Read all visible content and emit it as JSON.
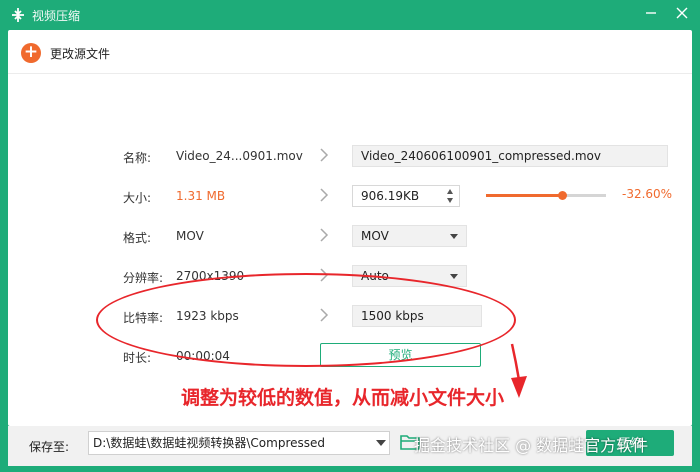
{
  "window": {
    "title": "视频压缩",
    "icons": {
      "logo": "compress-logo-icon",
      "minimize": "minimize-icon",
      "close": "close-icon"
    }
  },
  "toolbar": {
    "add_icon": "+",
    "change_source_label": "更改源文件"
  },
  "fields": {
    "name": {
      "label": "名称:",
      "source": "Video_24...0901.mov",
      "output": "Video_240606100901_compressed.mov"
    },
    "size": {
      "label": "大小:",
      "source": "1.31 MB",
      "output": "906.19KB",
      "percent": "-32.60%",
      "slider_value": 0.64
    },
    "format": {
      "label": "格式:",
      "source": "MOV",
      "output": "MOV"
    },
    "resolution": {
      "label": "分辨率:",
      "source": "2700x1390",
      "output": "Auto"
    },
    "bitrate": {
      "label": "比特率:",
      "source": "1923 kbps",
      "output": "1500 kbps"
    },
    "duration": {
      "label": "时长:",
      "source": "00:00:04"
    }
  },
  "preview_button": "预览",
  "annotation": {
    "text": "调整为较低的数值，从而减小文件大小"
  },
  "footer": {
    "save_label": "保存至:",
    "save_path": "D:\\数据蛙\\数据蛙视频转换器\\Compressed",
    "compress_button": "压缩"
  },
  "watermark": "掘金技术社区 @ 数据蛙官方软件",
  "colors": {
    "brand_green": "#1eac79",
    "accent_orange": "#f06a2e",
    "annotation_red": "#e8262b"
  }
}
